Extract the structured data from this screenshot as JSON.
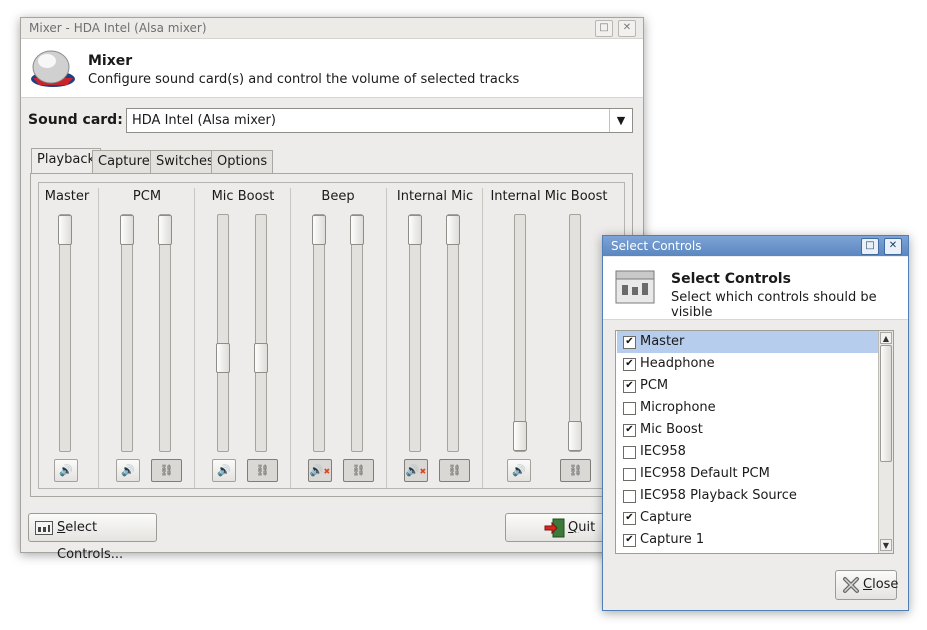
{
  "mixer": {
    "window_title": "Mixer - HDA Intel (Alsa mixer)",
    "title_buttons": {
      "maximize": "□",
      "close": "✕"
    },
    "header": {
      "title": "Mixer",
      "subtitle": "Configure sound card(s) and control the volume of selected tracks",
      "icon": "speaker-knob-icon"
    },
    "sound_card_label": "Sound card:",
    "sound_card_value": "HDA Intel (Alsa mixer)",
    "dropdown_arrow": "▼",
    "tabs": [
      {
        "label": "Playback",
        "active": true
      },
      {
        "label": "Capture",
        "active": false
      },
      {
        "label": "Switches",
        "active": false
      },
      {
        "label": "Options",
        "active": false
      }
    ],
    "channels": [
      {
        "name": "Master",
        "levels": [
          1.0
        ],
        "muted": false,
        "linked": false
      },
      {
        "name": "PCM",
        "levels": [
          1.0,
          1.0
        ],
        "muted": false,
        "linked": true
      },
      {
        "name": "Mic Boost",
        "levels": [
          0.38,
          0.38
        ],
        "muted": false,
        "linked": true
      },
      {
        "name": "Beep",
        "levels": [
          1.0,
          1.0
        ],
        "muted": true,
        "linked": true
      },
      {
        "name": "Internal Mic",
        "levels": [
          1.0,
          1.0
        ],
        "muted": true,
        "linked": true
      },
      {
        "name": "Internal Mic Boost",
        "levels": [
          0.0,
          0.0
        ],
        "muted": false,
        "linked": true
      }
    ],
    "icons": {
      "speaker": "🔊",
      "link": "⛓",
      "mute_mark": "✖"
    },
    "select_controls_button": {
      "mnemonic": "S",
      "rest": "elect Controls..."
    },
    "quit_button": {
      "mnemonic": "Q",
      "rest": "uit"
    }
  },
  "select_dialog": {
    "window_title": "Select Controls",
    "title_buttons": {
      "maximize": "□",
      "close": "✕"
    },
    "header": {
      "title": "Select Controls",
      "subtitle": "Select which controls should be visible"
    },
    "check_mark": "✔",
    "items": [
      {
        "label": "Master",
        "checked": true,
        "selected": true
      },
      {
        "label": "Headphone",
        "checked": true,
        "selected": false
      },
      {
        "label": "PCM",
        "checked": true,
        "selected": false
      },
      {
        "label": "Microphone",
        "checked": false,
        "selected": false
      },
      {
        "label": "Mic Boost",
        "checked": true,
        "selected": false
      },
      {
        "label": "IEC958",
        "checked": false,
        "selected": false
      },
      {
        "label": "IEC958 Default PCM",
        "checked": false,
        "selected": false
      },
      {
        "label": "IEC958 Playback Source",
        "checked": false,
        "selected": false
      },
      {
        "label": "Capture",
        "checked": true,
        "selected": false
      },
      {
        "label": "Capture 1",
        "checked": true,
        "selected": false
      }
    ],
    "scroll_up": "▲",
    "scroll_down": "▼",
    "close_button": {
      "mnemonic": "C",
      "rest": "lose"
    }
  }
}
